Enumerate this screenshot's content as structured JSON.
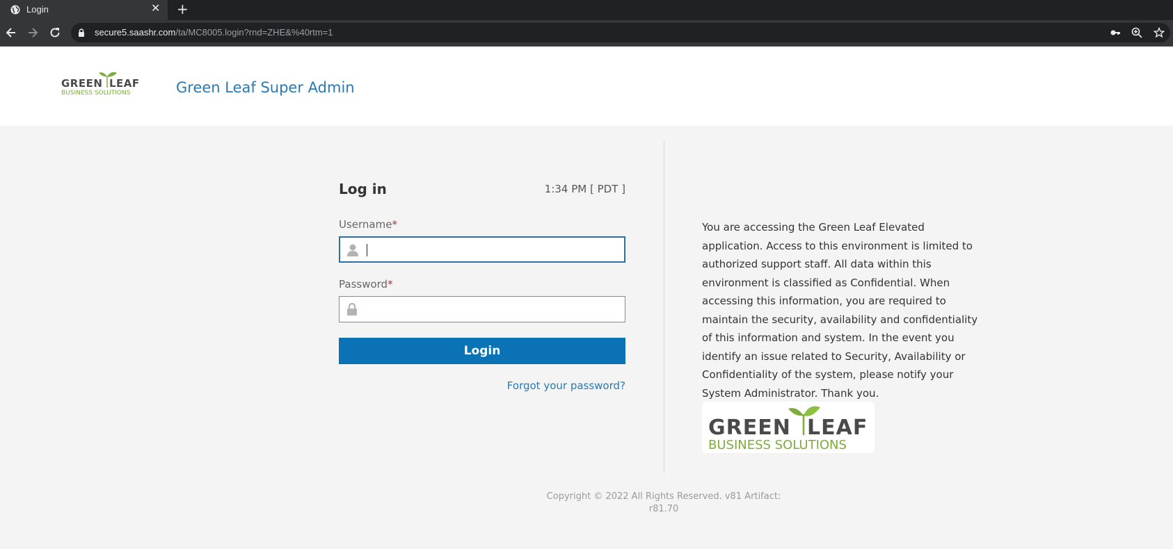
{
  "browser": {
    "tab_title": "Login",
    "url_host": "secure5.saashr.com",
    "url_path": "/ta/MC8005.login?rnd=ZHE&%40rtm=1"
  },
  "header": {
    "logo_top": "GREEN LEAF",
    "logo_bottom": "BUSINESS SOLUTIONS",
    "app_title": "Green Leaf Super Admin"
  },
  "login": {
    "title": "Log in",
    "time": "1:34 PM [ PDT ]",
    "username_label": "Username",
    "password_label": "Password",
    "required_mark": "*",
    "username_value": "",
    "password_value": "",
    "button_label": "Login",
    "forgot_link": "Forgot your password?"
  },
  "notice": {
    "text": "You are accessing the Green Leaf Elevated application. Access to this environment is limited to authorized support staff. All data within this environment is classified as Confidential. When accessing this information, you are required to maintain the security, availability and confidentiality of this information and system. In the event you identify an issue related to Security, Availability or Confidentiality of the system, please notify your System Administrator. Thank you."
  },
  "footer": {
    "line1": "Copyright © 2022 All Rights Reserved. v81 Artifact:",
    "line2": "r81.70"
  },
  "colors": {
    "brand_green": "#7cad3a",
    "brand_gray": "#4a4a4a",
    "link_blue": "#2b78b2",
    "button_blue": "#0a72b5"
  },
  "icons": [
    "globe-icon",
    "close-icon",
    "plus-icon",
    "back-icon",
    "forward-icon",
    "reload-icon",
    "lock-icon",
    "key-icon",
    "zoom-icon",
    "star-icon",
    "user-icon",
    "padlock-icon"
  ]
}
